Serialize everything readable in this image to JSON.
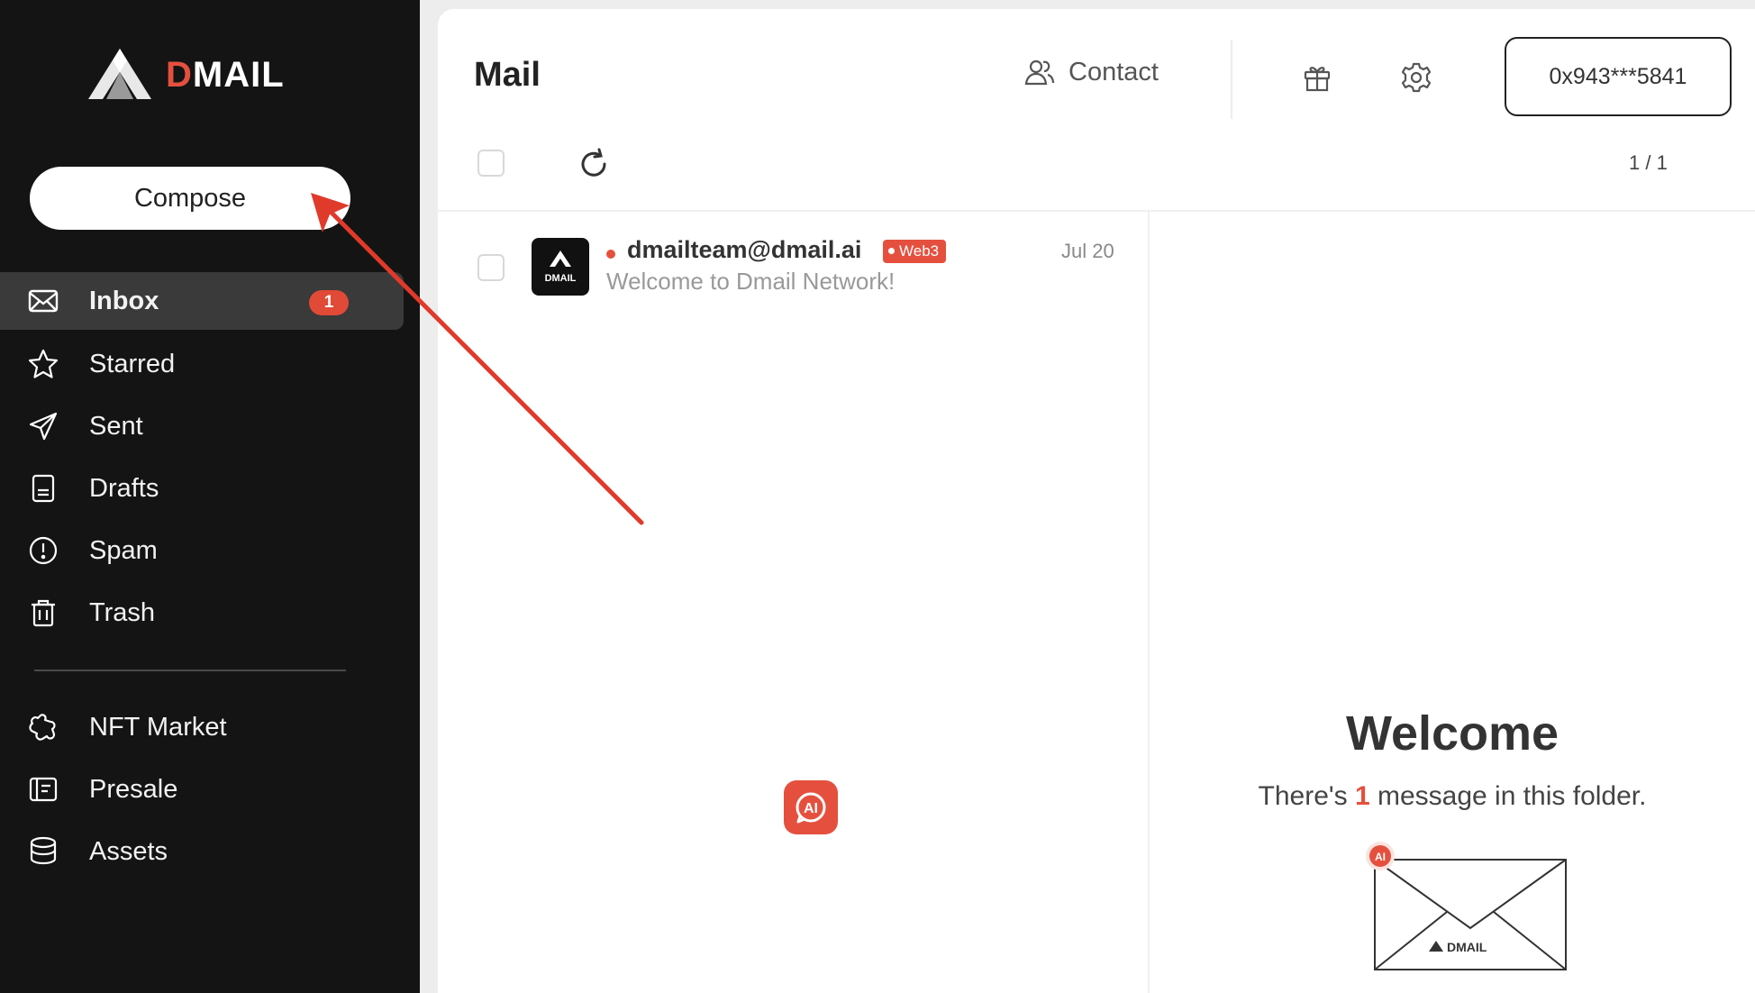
{
  "brand": {
    "logo_text_d": "D",
    "logo_text_rest": "MAIL"
  },
  "sidebar": {
    "compose_label": "Compose",
    "items": [
      {
        "label": "Inbox",
        "icon": "inbox-icon",
        "badge": "1",
        "active": true
      },
      {
        "label": "Starred",
        "icon": "star-icon"
      },
      {
        "label": "Sent",
        "icon": "send-icon"
      },
      {
        "label": "Drafts",
        "icon": "drafts-icon"
      },
      {
        "label": "Spam",
        "icon": "spam-icon"
      },
      {
        "label": "Trash",
        "icon": "trash-icon"
      }
    ],
    "extra_items": [
      {
        "label": "NFT Market",
        "icon": "nft-market-icon"
      },
      {
        "label": "Presale",
        "icon": "presale-icon"
      },
      {
        "label": "Assets",
        "icon": "assets-icon"
      }
    ]
  },
  "header": {
    "title": "Mail",
    "contact_label": "Contact",
    "wallet": "0x943***5841"
  },
  "toolbar": {
    "pager": "1 / 1"
  },
  "mail_list": [
    {
      "sender": "dmailteam@dmail.ai",
      "tag": "Web3",
      "subject": "Welcome to Dmail Network!",
      "date": "Jul 20",
      "avatar_text": "DMAIL"
    }
  ],
  "ai_button": {
    "label": "AI"
  },
  "welcome": {
    "title": "Welcome",
    "msg_before": "There's ",
    "count": "1",
    "msg_after": " message in this folder.",
    "envelope_badge": "AI",
    "envelope_brand": "DMAIL"
  },
  "colors": {
    "accent": "#e5503e",
    "sidebar_bg": "#141414",
    "active_bg": "#3a3a3a"
  }
}
